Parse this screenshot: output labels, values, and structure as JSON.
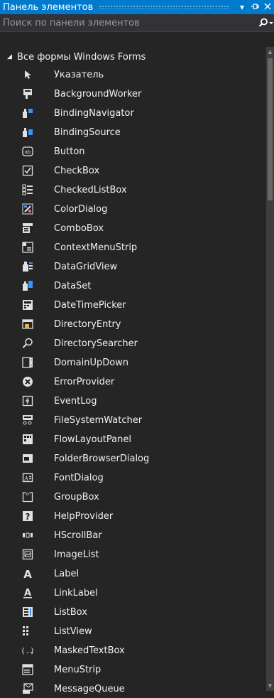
{
  "panel": {
    "title": "Панель элементов",
    "dropdown_icon": "chevron-down-icon",
    "pin_icon": "pin-icon",
    "close_icon": "close-icon"
  },
  "search": {
    "placeholder": "Поиск по панели элементов",
    "icon": "search-icon"
  },
  "group": {
    "label": "Все формы Windows Forms",
    "expanded": true
  },
  "items": [
    {
      "label": "Указатель",
      "icon": "pointer-icon"
    },
    {
      "label": "BackgroundWorker",
      "icon": "backgroundworker-icon"
    },
    {
      "label": "BindingNavigator",
      "icon": "bindingnavigator-icon"
    },
    {
      "label": "BindingSource",
      "icon": "bindingsource-icon"
    },
    {
      "label": "Button",
      "icon": "button-icon"
    },
    {
      "label": "CheckBox",
      "icon": "checkbox-icon"
    },
    {
      "label": "CheckedListBox",
      "icon": "checkedlistbox-icon"
    },
    {
      "label": "ColorDialog",
      "icon": "colordialog-icon"
    },
    {
      "label": "ComboBox",
      "icon": "combobox-icon"
    },
    {
      "label": "ContextMenuStrip",
      "icon": "contextmenustrip-icon"
    },
    {
      "label": "DataGridView",
      "icon": "datagridview-icon"
    },
    {
      "label": "DataSet",
      "icon": "dataset-icon"
    },
    {
      "label": "DateTimePicker",
      "icon": "datetimepicker-icon"
    },
    {
      "label": "DirectoryEntry",
      "icon": "directoryentry-icon"
    },
    {
      "label": "DirectorySearcher",
      "icon": "directorysearcher-icon"
    },
    {
      "label": "DomainUpDown",
      "icon": "domainupdown-icon"
    },
    {
      "label": "ErrorProvider",
      "icon": "errorprovider-icon"
    },
    {
      "label": "EventLog",
      "icon": "eventlog-icon"
    },
    {
      "label": "FileSystemWatcher",
      "icon": "filesystemwatcher-icon"
    },
    {
      "label": "FlowLayoutPanel",
      "icon": "flowlayoutpanel-icon"
    },
    {
      "label": "FolderBrowserDialog",
      "icon": "folderbrowserdialog-icon"
    },
    {
      "label": "FontDialog",
      "icon": "fontdialog-icon"
    },
    {
      "label": "GroupBox",
      "icon": "groupbox-icon"
    },
    {
      "label": "HelpProvider",
      "icon": "helpprovider-icon"
    },
    {
      "label": "HScrollBar",
      "icon": "hscrollbar-icon"
    },
    {
      "label": "ImageList",
      "icon": "imagelist-icon"
    },
    {
      "label": "Label",
      "icon": "label-icon"
    },
    {
      "label": "LinkLabel",
      "icon": "linklabel-icon"
    },
    {
      "label": "ListBox",
      "icon": "listbox-icon"
    },
    {
      "label": "ListView",
      "icon": "listview-icon"
    },
    {
      "label": "MaskedTextBox",
      "icon": "maskedtextbox-icon"
    },
    {
      "label": "MenuStrip",
      "icon": "menustrip-icon"
    },
    {
      "label": "MessageQueue",
      "icon": "messagequeue-icon"
    }
  ],
  "colors": {
    "titlebar": "#007acc",
    "background": "#252526",
    "text": "#f1f1f1",
    "icon_accent": "#3794ff",
    "error_icon": "#e8e8e8"
  }
}
